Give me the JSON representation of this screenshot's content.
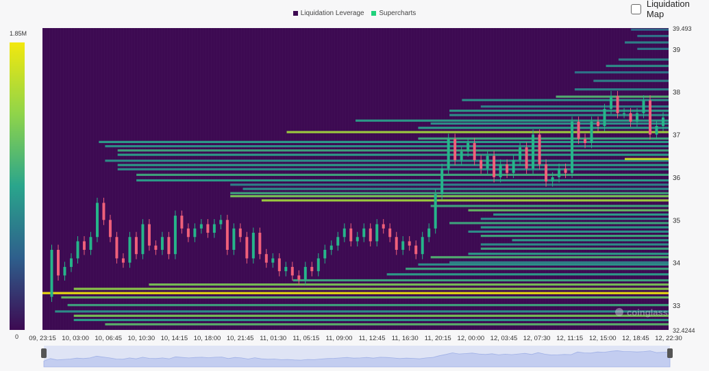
{
  "toggle": {
    "label": "Liquidation Map"
  },
  "colors": {
    "background": "#3d0a52",
    "leverage": "#3d0a52",
    "supercharts": "#1fd17b",
    "candle_up": "#26b58a",
    "candle_down": "#f0607a"
  },
  "watermark": "coinglass",
  "colorbar": {
    "max_label": "1.85M",
    "min_label": "0"
  },
  "chart_data": {
    "type": "heatmap",
    "title": "",
    "legend": [
      {
        "name": "Liquidation Leverage",
        "color": "#3d0a52"
      },
      {
        "name": "Supercharts",
        "color": "#1fd17b"
      }
    ],
    "legend_position": "top-center",
    "x_ticks": [
      "09, 23:15",
      "10, 03:00",
      "10, 06:45",
      "10, 10:30",
      "10, 14:15",
      "10, 18:00",
      "10, 21:45",
      "11, 01:30",
      "11, 05:15",
      "11, 09:00",
      "11, 12:45",
      "11, 16:30",
      "11, 20:15",
      "12, 00:00",
      "12, 03:45",
      "12, 07:30",
      "12, 11:15",
      "12, 15:00",
      "12, 18:45",
      "12, 22:30"
    ],
    "y_ticks": [
      33,
      34,
      35,
      36,
      37,
      38,
      39
    ],
    "y_top_label": "39.493",
    "y_bottom_label": "32.4244",
    "ylim": [
      32.4244,
      39.493
    ],
    "colorscale_max": 1850000,
    "price_path": [
      [
        0,
        33.2
      ],
      [
        1,
        34.3
      ],
      [
        2,
        33.7
      ],
      [
        3,
        33.9
      ],
      [
        4,
        34.1
      ],
      [
        5,
        34.5
      ],
      [
        6,
        34.3
      ],
      [
        7,
        34.6
      ],
      [
        8,
        35.4
      ],
      [
        9,
        35.0
      ],
      [
        10,
        34.6
      ],
      [
        11,
        34.1
      ],
      [
        12,
        34.0
      ],
      [
        13,
        34.6
      ],
      [
        14,
        34.2
      ],
      [
        15,
        34.9
      ],
      [
        16,
        34.4
      ],
      [
        17,
        34.3
      ],
      [
        18,
        34.6
      ],
      [
        19,
        34.2
      ],
      [
        20,
        35.1
      ],
      [
        21,
        34.8
      ],
      [
        22,
        34.6
      ],
      [
        23,
        34.8
      ],
      [
        24,
        34.9
      ],
      [
        25,
        34.7
      ],
      [
        26,
        34.9
      ],
      [
        27,
        35.0
      ],
      [
        28,
        34.3
      ],
      [
        29,
        34.8
      ],
      [
        30,
        34.6
      ],
      [
        31,
        34.1
      ],
      [
        32,
        34.7
      ],
      [
        33,
        34.2
      ],
      [
        34,
        34.0
      ],
      [
        35,
        34.1
      ],
      [
        36,
        33.8
      ],
      [
        37,
        33.9
      ],
      [
        38,
        33.7
      ],
      [
        39,
        33.6
      ],
      [
        40,
        33.9
      ],
      [
        41,
        33.8
      ],
      [
        42,
        34.1
      ],
      [
        43,
        34.3
      ],
      [
        44,
        34.4
      ],
      [
        45,
        34.6
      ],
      [
        46,
        34.8
      ],
      [
        47,
        34.5
      ],
      [
        48,
        34.6
      ],
      [
        49,
        34.8
      ],
      [
        50,
        34.5
      ],
      [
        51,
        34.9
      ],
      [
        52,
        34.8
      ],
      [
        53,
        34.6
      ],
      [
        54,
        34.3
      ],
      [
        55,
        34.5
      ],
      [
        56,
        34.4
      ],
      [
        57,
        34.2
      ],
      [
        58,
        34.6
      ],
      [
        59,
        34.8
      ],
      [
        60,
        35.6
      ],
      [
        61,
        36.2
      ],
      [
        62,
        36.9
      ],
      [
        63,
        36.4
      ],
      [
        64,
        36.6
      ],
      [
        65,
        36.8
      ],
      [
        66,
        36.4
      ],
      [
        67,
        36.2
      ],
      [
        68,
        36.5
      ],
      [
        69,
        36.0
      ],
      [
        70,
        36.3
      ],
      [
        71,
        36.1
      ],
      [
        72,
        36.4
      ],
      [
        73,
        36.7
      ],
      [
        74,
        36.2
      ],
      [
        75,
        37.0
      ],
      [
        76,
        36.3
      ],
      [
        77,
        35.9
      ],
      [
        78,
        36.0
      ],
      [
        79,
        36.2
      ],
      [
        80,
        36.1
      ],
      [
        81,
        37.3
      ],
      [
        82,
        36.9
      ],
      [
        83,
        36.8
      ],
      [
        84,
        37.3
      ],
      [
        85,
        37.2
      ],
      [
        86,
        37.6
      ],
      [
        87,
        37.9
      ],
      [
        88,
        37.5
      ],
      [
        89,
        37.5
      ],
      [
        90,
        37.3
      ],
      [
        91,
        37.5
      ],
      [
        92,
        37.8
      ],
      [
        93,
        37.0
      ],
      [
        94,
        37.2
      ],
      [
        95,
        37.4
      ]
    ],
    "liquidation_bands": [
      [
        32.55,
        0.62,
        0.1
      ],
      [
        32.65,
        0.5,
        0.05
      ],
      [
        32.75,
        0.7,
        0.05
      ],
      [
        32.85,
        0.45,
        0.02
      ],
      [
        33.0,
        0.55,
        0.04
      ],
      [
        33.18,
        0.65,
        0.03
      ],
      [
        33.28,
        1.0,
        0.0
      ],
      [
        33.38,
        0.75,
        0.05
      ],
      [
        33.48,
        0.7,
        0.17
      ],
      [
        33.58,
        0.55,
        0.4
      ],
      [
        33.72,
        0.5,
        0.55
      ],
      [
        33.85,
        0.55,
        0.58
      ],
      [
        33.95,
        0.45,
        0.6
      ],
      [
        34.0,
        0.4,
        0.65
      ],
      [
        34.12,
        0.6,
        0.62
      ],
      [
        34.2,
        0.5,
        0.68
      ],
      [
        34.32,
        0.55,
        0.7
      ],
      [
        34.42,
        0.45,
        0.7
      ],
      [
        34.52,
        0.5,
        0.75
      ],
      [
        34.62,
        0.55,
        0.7
      ],
      [
        34.72,
        0.45,
        0.68
      ],
      [
        34.82,
        0.5,
        0.7
      ],
      [
        34.92,
        0.55,
        0.65
      ],
      [
        35.02,
        0.45,
        0.7
      ],
      [
        35.12,
        0.5,
        0.72
      ],
      [
        35.22,
        0.65,
        0.68
      ],
      [
        35.32,
        0.55,
        0.62
      ],
      [
        35.45,
        0.8,
        0.35
      ],
      [
        35.55,
        0.7,
        0.3
      ],
      [
        35.62,
        0.55,
        0.3
      ],
      [
        35.72,
        0.45,
        0.32
      ],
      [
        35.82,
        0.4,
        0.3
      ],
      [
        35.92,
        0.5,
        0.15
      ],
      [
        36.05,
        0.55,
        0.15
      ],
      [
        36.18,
        0.45,
        0.12
      ],
      [
        36.28,
        0.5,
        0.12
      ],
      [
        36.38,
        0.45,
        0.1
      ],
      [
        36.42,
        0.9,
        0.93
      ],
      [
        36.52,
        0.5,
        0.12
      ],
      [
        36.62,
        0.55,
        0.12
      ],
      [
        36.72,
        0.45,
        0.1
      ],
      [
        36.82,
        0.5,
        0.09
      ],
      [
        36.9,
        0.55,
        0.6
      ],
      [
        37.05,
        0.8,
        0.39
      ],
      [
        37.15,
        0.5,
        0.6
      ],
      [
        37.25,
        0.45,
        0.62
      ],
      [
        37.32,
        0.5,
        0.5
      ],
      [
        37.45,
        0.45,
        0.65
      ],
      [
        37.55,
        0.5,
        0.65
      ],
      [
        37.65,
        0.4,
        0.7
      ],
      [
        37.8,
        0.45,
        0.67
      ],
      [
        37.88,
        0.6,
        0.82
      ],
      [
        38.05,
        0.4,
        0.85
      ],
      [
        38.25,
        0.4,
        0.88
      ],
      [
        38.45,
        0.35,
        0.85
      ],
      [
        38.6,
        0.45,
        0.9
      ],
      [
        38.75,
        0.4,
        0.92
      ],
      [
        39.0,
        0.35,
        0.95
      ],
      [
        39.15,
        0.4,
        0.93
      ],
      [
        39.3,
        0.35,
        0.95
      ],
      [
        39.45,
        0.3,
        0.94
      ]
    ]
  }
}
